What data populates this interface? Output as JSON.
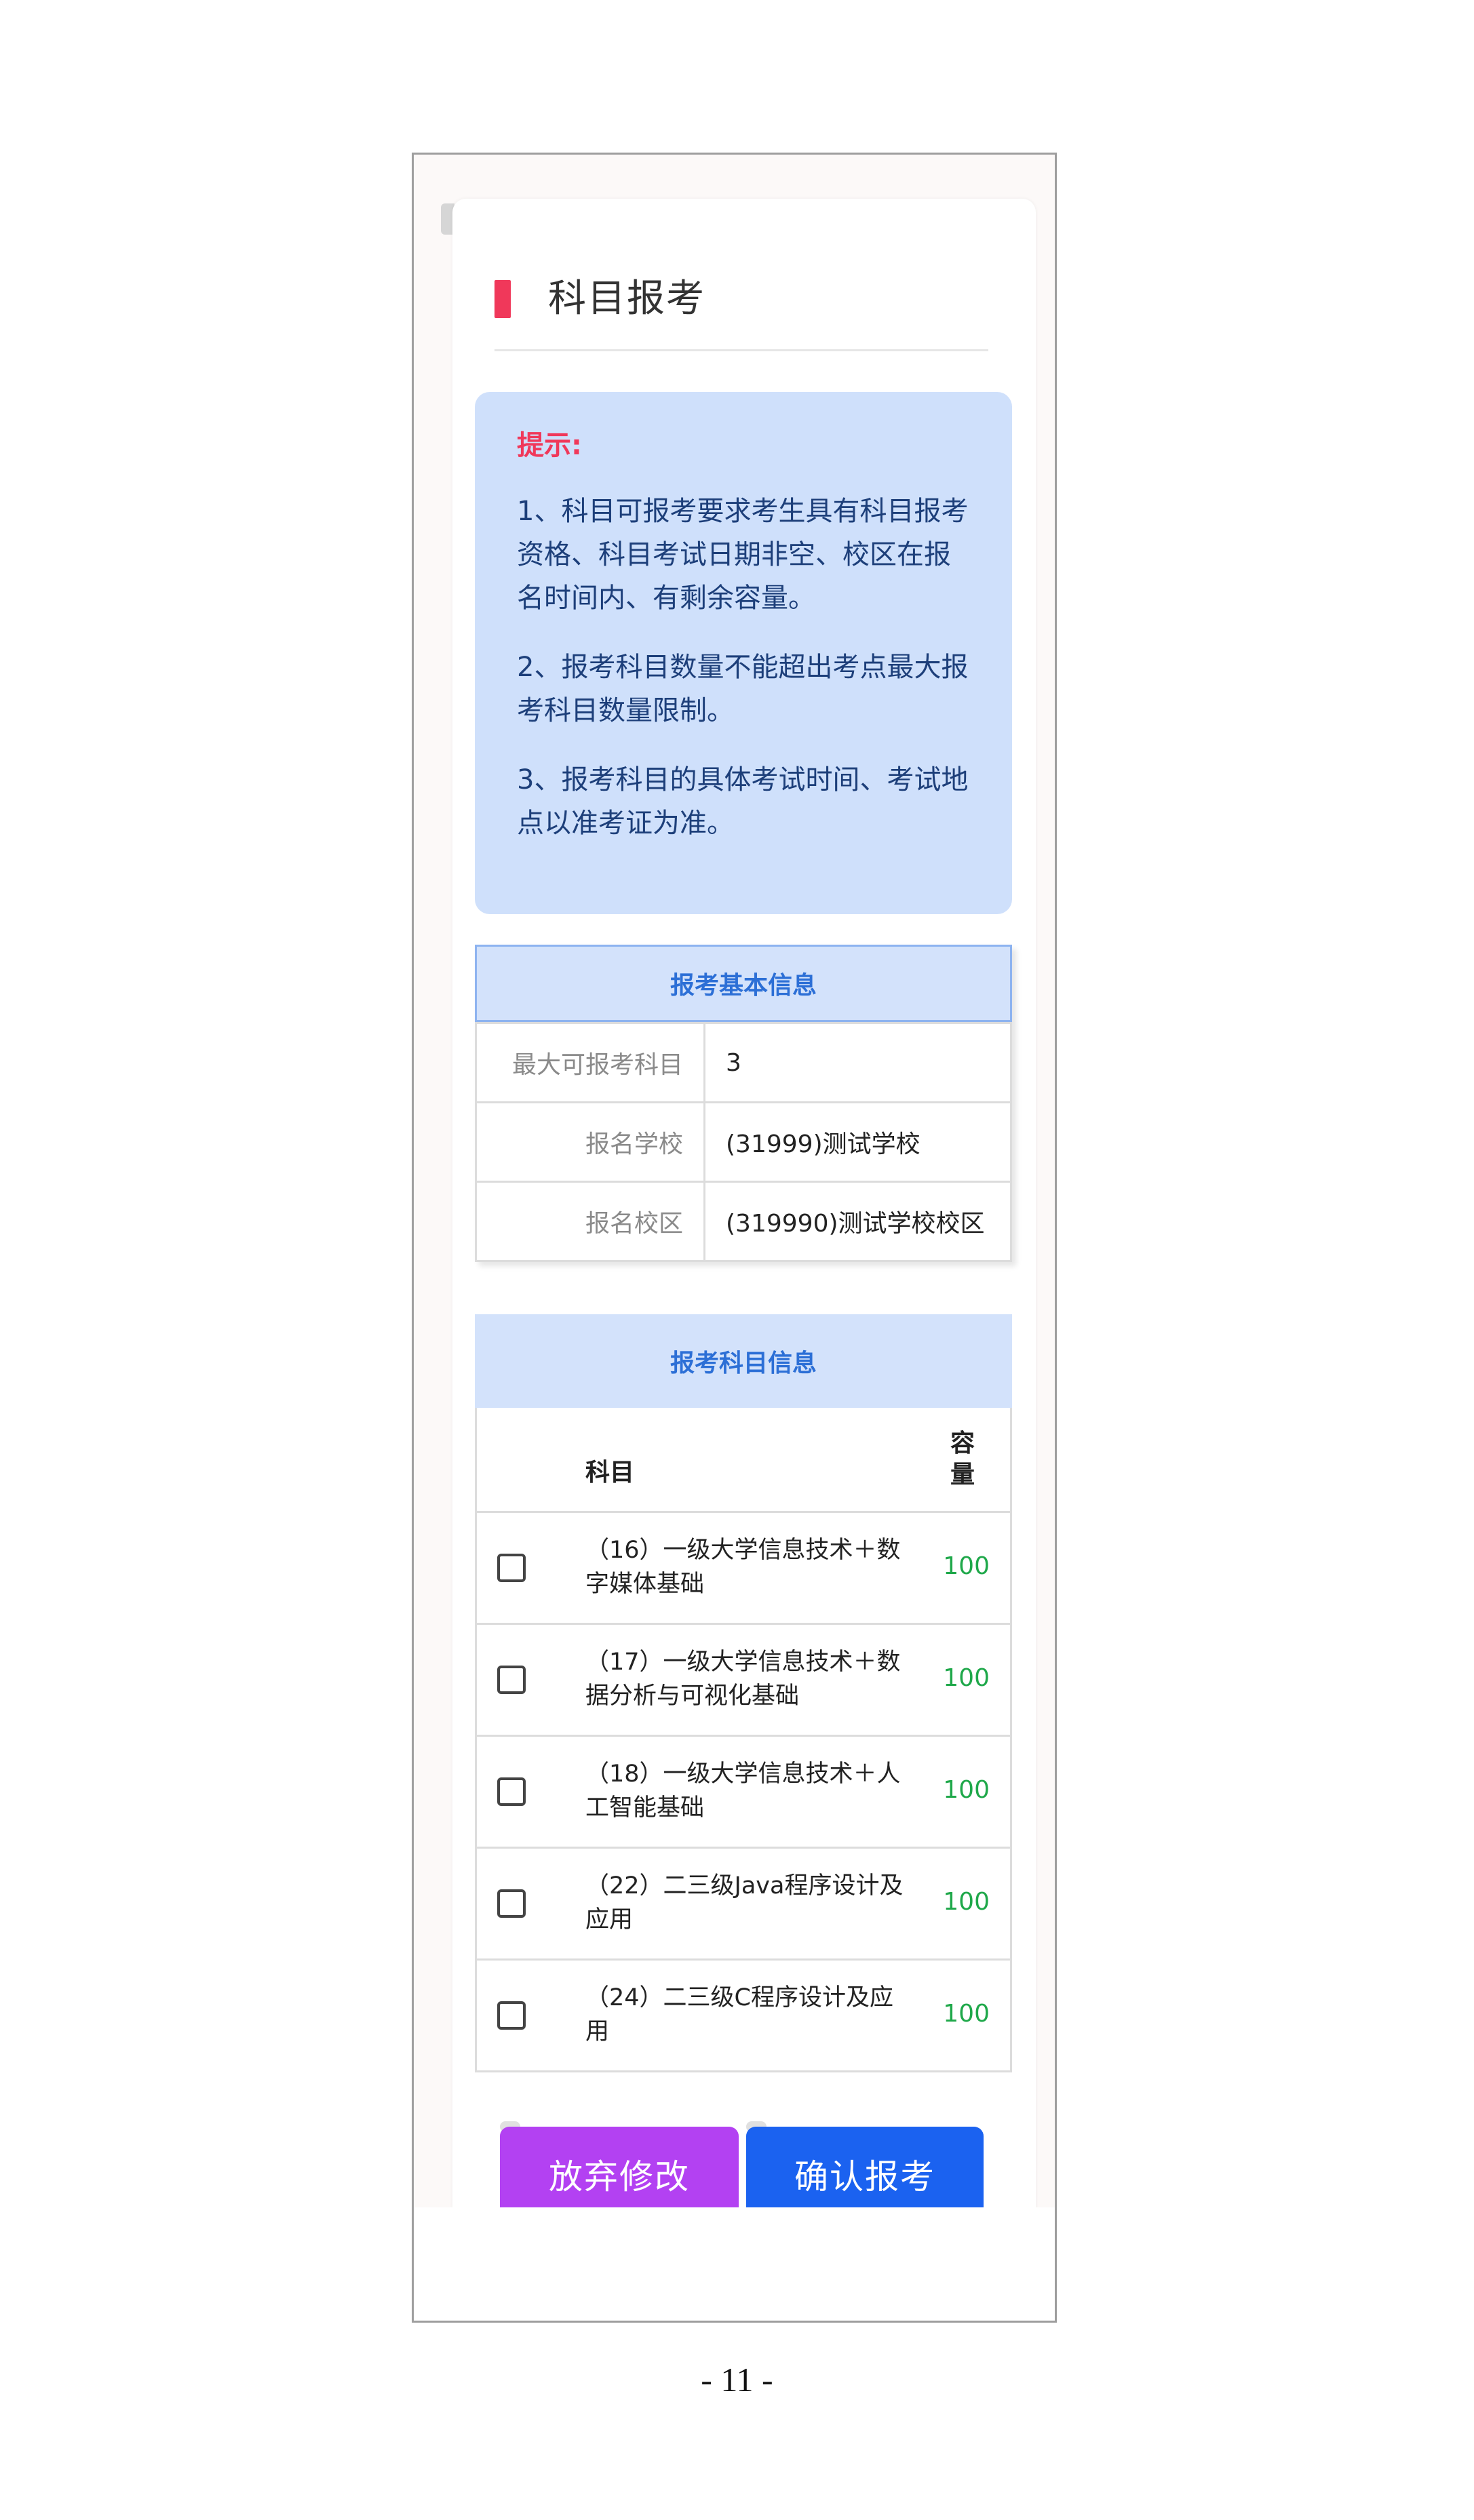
{
  "header": {
    "title": "科目报考"
  },
  "tips": {
    "title": "提示:",
    "items": [
      "1、科目可报考要求考生具有科目报考资格、科目考试日期非空、校区在报名时间内、有剩余容量。",
      "2、报考科目数量不能超出考点最大报考科目数量限制。",
      "3、报考科目的具体考试时间、考试地点以准考证为准。"
    ]
  },
  "basic_info": {
    "title": "报考基本信息",
    "rows": [
      {
        "label": "最大可报考科目",
        "value": "3"
      },
      {
        "label": "报名学校",
        "value": "(31999)测试学校"
      },
      {
        "label": "报名校区",
        "value": "(319990)测试学校校区"
      }
    ]
  },
  "subjects": {
    "title": "报考科目信息",
    "col_subject": "科目",
    "col_capacity": "容量",
    "rows": [
      {
        "name": "（16）一级大学信息技术＋数字媒体基础",
        "capacity": "100"
      },
      {
        "name": "（17）一级大学信息技术＋数据分析与可视化基础",
        "capacity": "100"
      },
      {
        "name": "（18）一级大学信息技术＋人工智能基础",
        "capacity": "100"
      },
      {
        "name": "（22）二三级Java程序设计及应用",
        "capacity": "100"
      },
      {
        "name": "（24）二三级C程序设计及应用",
        "capacity": "100"
      }
    ]
  },
  "buttons": {
    "cancel": "放弃修改",
    "confirm": "确认报考"
  },
  "page_number": "- 11 -",
  "colors": {
    "accent_red": "#f0385a",
    "tips_bg": "#cfe0fb",
    "table_head": "#2c6fd6",
    "capacity_green": "#1fa84a",
    "cancel_purple": "#b341f2",
    "confirm_blue": "#1b62f0"
  }
}
